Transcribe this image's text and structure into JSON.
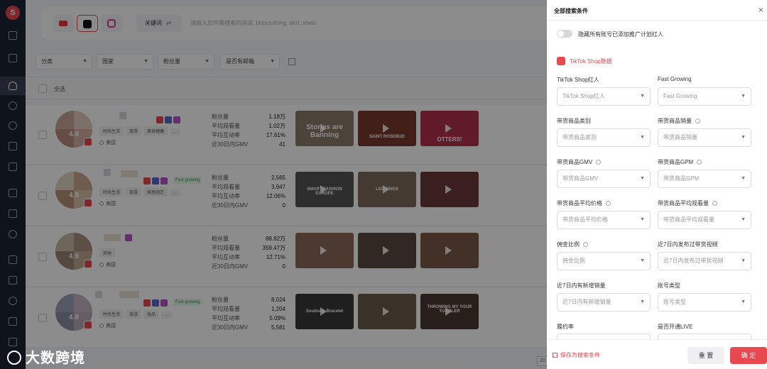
{
  "search": {
    "platforms": [
      {
        "name": "youtube",
        "icon": "youtube-icon"
      },
      {
        "name": "tiktok",
        "icon": "tiktok-icon"
      },
      {
        "name": "instagram",
        "icon": "instagram-icon"
      }
    ],
    "keyword_mode": "关键词",
    "placeholder": "请输入您所需搜索的词语, tiktoclothing, skirt, shein"
  },
  "filters": [
    "分类",
    "国家",
    "粉丝量",
    "是否有邮箱"
  ],
  "select_all": "全选",
  "stat_labels": [
    "粉丝量",
    "平均观看量",
    "平均互动率",
    "近30日内GMV"
  ],
  "influencers": [
    {
      "score": "4.9",
      "badges": [],
      "tags": [
        "时尚生活",
        "旅游",
        "美容健康",
        "..."
      ],
      "country": "美国",
      "stats": [
        "1.18万",
        "1.02万",
        "17.61%",
        "41"
      ],
      "thumbs": [
        {
          "caption": "Stories are Banning",
          "bg": "#8a7a6b"
        },
        {
          "caption": "SAINT ROSEBUD",
          "bg": "#7a3a30"
        },
        {
          "caption": "OTTERS!",
          "bg": "#b0304a"
        }
      ]
    },
    {
      "score": "4.9",
      "badges": [
        "Fast growing"
      ],
      "tags": [
        "时尚生活",
        "旅游",
        "家居园艺",
        "..."
      ],
      "country": "美国",
      "stats": [
        "2,565",
        "3,947",
        "12.06%",
        "0"
      ],
      "thumbs": [
        {
          "caption": "SMART FASHION EUROPE",
          "bg": "#555555"
        },
        {
          "caption": "LEGGINGS",
          "bg": "#7d6a5a"
        },
        {
          "caption": "",
          "bg": "#6b3a3a"
        }
      ]
    },
    {
      "score": "4.9",
      "badges": [],
      "tags": [
        "其他"
      ],
      "country": "美国",
      "stats": [
        "88.82万",
        "359.47万",
        "12.71%",
        "0"
      ],
      "thumbs": [
        {
          "caption": "",
          "bg": "#8a6a5a"
        },
        {
          "caption": "",
          "bg": "#5a4a40"
        },
        {
          "caption": "",
          "bg": "#7a5a4a"
        }
      ]
    },
    {
      "score": "4.8",
      "badges": [
        "Fast growing"
      ],
      "tags": [
        "时尚生活",
        "旅游",
        "食品",
        "..."
      ],
      "country": "美国",
      "stats": [
        "8,024",
        "1,204",
        "5.09%",
        "5,581"
      ],
      "thumbs": [
        {
          "caption": "Soulmate Bracelet",
          "bg": "#3a3a3a"
        },
        {
          "caption": "",
          "bg": "#6a5a4a"
        },
        {
          "caption": "THROWING MY YOUR TUMBLER",
          "bg": "#4a3a30"
        }
      ]
    }
  ],
  "pager": "20",
  "watermark": "大数跨境",
  "drawer": {
    "title": "全部搜索条件",
    "hide_toggle": "隐藏所有账号已添加推广计划红人",
    "section": "TikTok Shop数据",
    "fields": [
      {
        "label": "TikTok Shop红人",
        "placeholder": "TikTok Shop红人",
        "info": false
      },
      {
        "label": "Fast Growing",
        "placeholder": "Fast Growing",
        "info": false
      },
      {
        "label": "带货商品类别",
        "placeholder": "带货商品类别",
        "info": false
      },
      {
        "label": "带货商品销量",
        "placeholder": "带货商品销量",
        "info": true
      },
      {
        "label": "带货商品GMV",
        "placeholder": "带货商品GMV",
        "info": true
      },
      {
        "label": "带货商品GPM",
        "placeholder": "带货商品GPM",
        "info": true
      },
      {
        "label": "带货商品平均价格",
        "placeholder": "带货商品平均价格",
        "info": true
      },
      {
        "label": "带货商品平均观看量",
        "placeholder": "带货商品平均观看量",
        "info": true
      },
      {
        "label": "佣金比例",
        "placeholder": "佣金比例",
        "info": true
      },
      {
        "label": "近7日内发布过带货视频",
        "placeholder": "近7日内发布过带货视频",
        "info": false
      },
      {
        "label": "近7日内有新增销量",
        "placeholder": "近7日内有新增销量",
        "info": false
      },
      {
        "label": "账号类型",
        "placeholder": "账号类型",
        "info": false
      },
      {
        "label": "履约率",
        "placeholder": "",
        "info": false
      },
      {
        "label": "是否开通LIVE",
        "placeholder": "",
        "info": false
      }
    ],
    "save_label": "保存为搜索条件",
    "reset_label": "重 置",
    "confirm_label": "确 定"
  },
  "colors": {
    "accent": "#e8484f",
    "rail": "#1d2433",
    "fast_growing": "#3a9a58"
  }
}
